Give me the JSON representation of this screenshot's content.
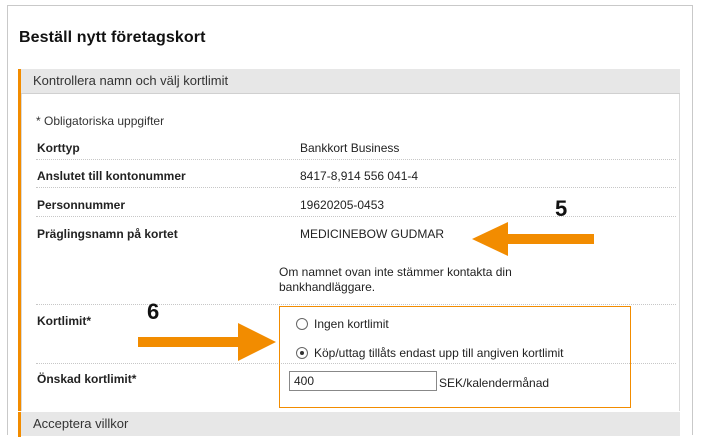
{
  "page": {
    "title": "Beställ nytt företagskort"
  },
  "section1": {
    "header": "Kontrollera namn och välj kortlimit",
    "required_note": "* Obligatoriska uppgifter",
    "rows": [
      {
        "label": "Korttyp",
        "value": "Bankkort Business"
      },
      {
        "label": "Anslutet till kontonummer",
        "value": "8417-8,914 556 041-4"
      },
      {
        "label": "Personnummer",
        "value": "19620205-0453"
      },
      {
        "label": "Präglingsnamn på kortet",
        "value": "MEDICINEBOW GUDMAR"
      }
    ],
    "name_note": "Om namnet ovan inte stämmer kontakta din bankhandläggare.",
    "limit": {
      "label": "Kortlimit*",
      "options": [
        {
          "label": "Ingen kortlimit",
          "checked": false
        },
        {
          "label": "Köp/uttag tillåts endast upp till angiven kortlimit",
          "checked": true
        }
      ]
    },
    "desired_limit": {
      "label": "Önskad kortlimit*",
      "value": "400",
      "unit": "SEK/kalendermånad"
    }
  },
  "section2": {
    "header": "Acceptera villkor"
  },
  "annotations": {
    "five": "5",
    "six": "6",
    "arrow_color": "#f28c00"
  }
}
